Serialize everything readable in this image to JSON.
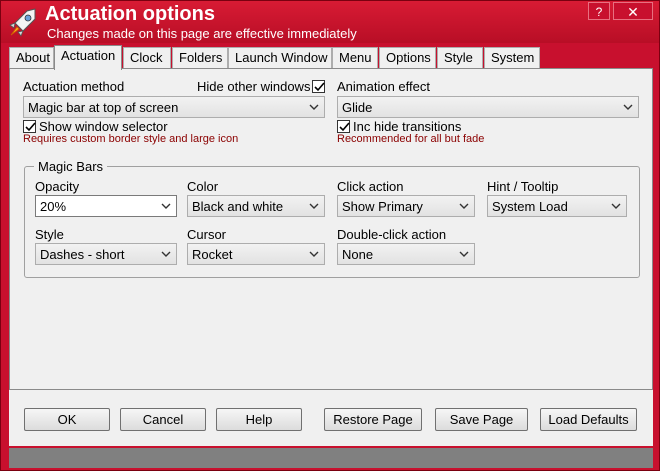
{
  "window": {
    "title": "Actuation options",
    "subtitle": "Changes made on this page are effective immediately",
    "help_button": "?",
    "close_button": "✕"
  },
  "tabs": [
    {
      "label": "About",
      "active": false
    },
    {
      "label": "Actuation",
      "active": true
    },
    {
      "label": "Clock",
      "active": false
    },
    {
      "label": "Folders",
      "active": false
    },
    {
      "label": "Launch Window",
      "active": false
    },
    {
      "label": "Menu",
      "active": false
    },
    {
      "label": "Options",
      "active": false
    },
    {
      "label": "Style",
      "active": false
    },
    {
      "label": "System",
      "active": false
    }
  ],
  "actuation": {
    "method_label": "Actuation method",
    "method_value": "Magic bar at top of screen",
    "hide_other_windows_label": "Hide other windows",
    "hide_other_windows_checked": true,
    "show_window_selector_label": "Show window selector",
    "show_window_selector_checked": true,
    "show_window_selector_hint": "Requires custom border style and large icon",
    "animation_label": "Animation effect",
    "animation_value": "Glide",
    "inc_hide_label": "Inc hide transitions",
    "inc_hide_checked": true,
    "inc_hide_hint": "Recommended for all but fade"
  },
  "magic_bars": {
    "title": "Magic Bars",
    "opacity_label": "Opacity",
    "opacity_value": "20%",
    "color_label": "Color",
    "color_value": "Black and white",
    "click_action_label": "Click action",
    "click_action_value": "Show Primary",
    "hint_label": "Hint / Tooltip",
    "hint_value": "System Load",
    "style_label": "Style",
    "style_value": "Dashes - short",
    "cursor_label": "Cursor",
    "cursor_value": "Rocket",
    "dblclick_label": "Double-click action",
    "dblclick_value": "None"
  },
  "buttons": {
    "ok": "OK",
    "cancel": "Cancel",
    "help": "Help",
    "restore": "Restore Page",
    "save": "Save Page",
    "load_defaults": "Load Defaults"
  },
  "colors": {
    "window_frame": "#c8102e",
    "hint_text": "#8b0000",
    "panel": "#f0f0f0"
  }
}
